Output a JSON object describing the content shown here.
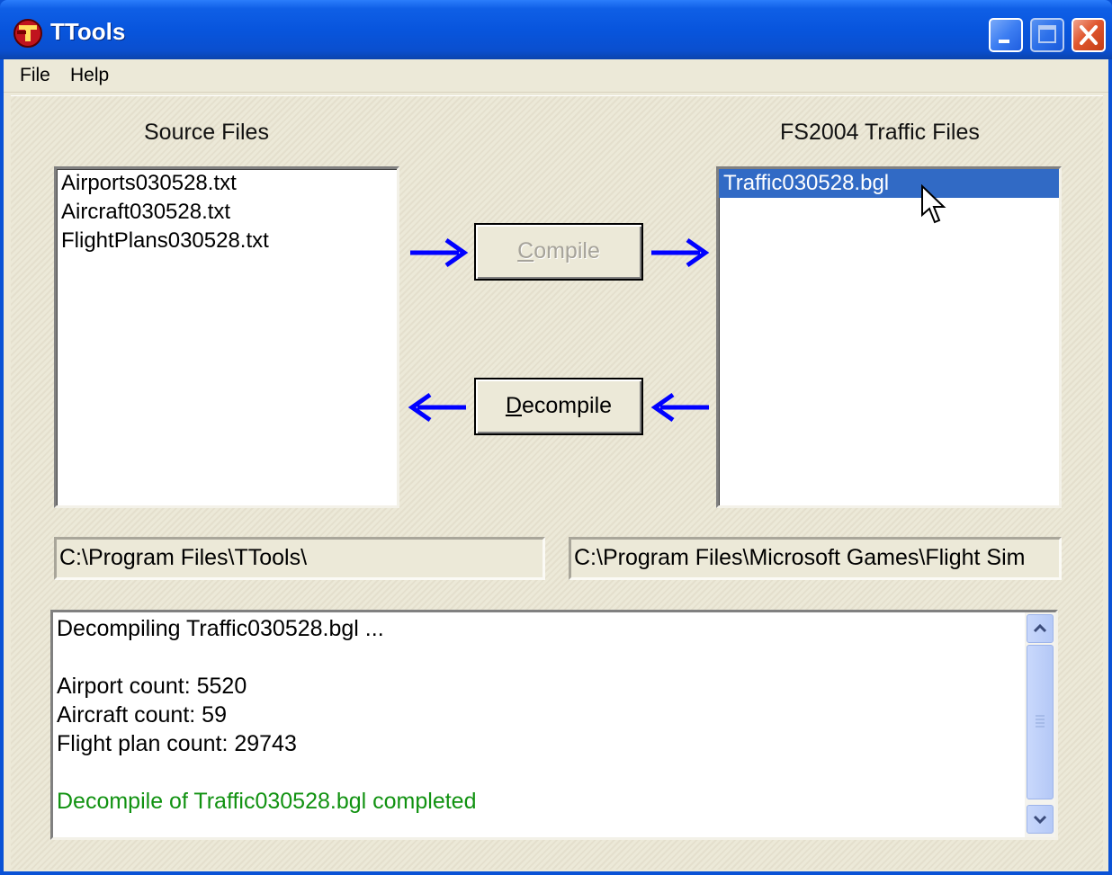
{
  "window": {
    "title": "TTools"
  },
  "menu": {
    "file": "File",
    "help": "Help"
  },
  "source": {
    "heading": "Source Files",
    "items": [
      "Airports030528.txt",
      "Aircraft030528.txt",
      "FlightPlans030528.txt"
    ],
    "path": "C:\\Program Files\\TTools\\"
  },
  "traffic": {
    "heading": "FS2004 Traffic Files",
    "items": [
      "Traffic030528.bgl"
    ],
    "selected_index": 0,
    "path": "C:\\Program Files\\Microsoft Games\\Flight Sim"
  },
  "buttons": {
    "compile": {
      "label": "Compile",
      "enabled": false
    },
    "decompile": {
      "label": "Decompile",
      "enabled": true
    }
  },
  "log": {
    "lines": [
      "Decompiling Traffic030528.bgl ...",
      "",
      "Airport count: 5520",
      "Aircraft count: 59",
      "Flight plan count: 29743",
      "",
      "Decompile of Traffic030528.bgl completed"
    ],
    "success_color": "#119211"
  },
  "colors": {
    "title_bar": "#0a52d6",
    "arrow": "#0000ff",
    "selection": "#316ac5"
  }
}
